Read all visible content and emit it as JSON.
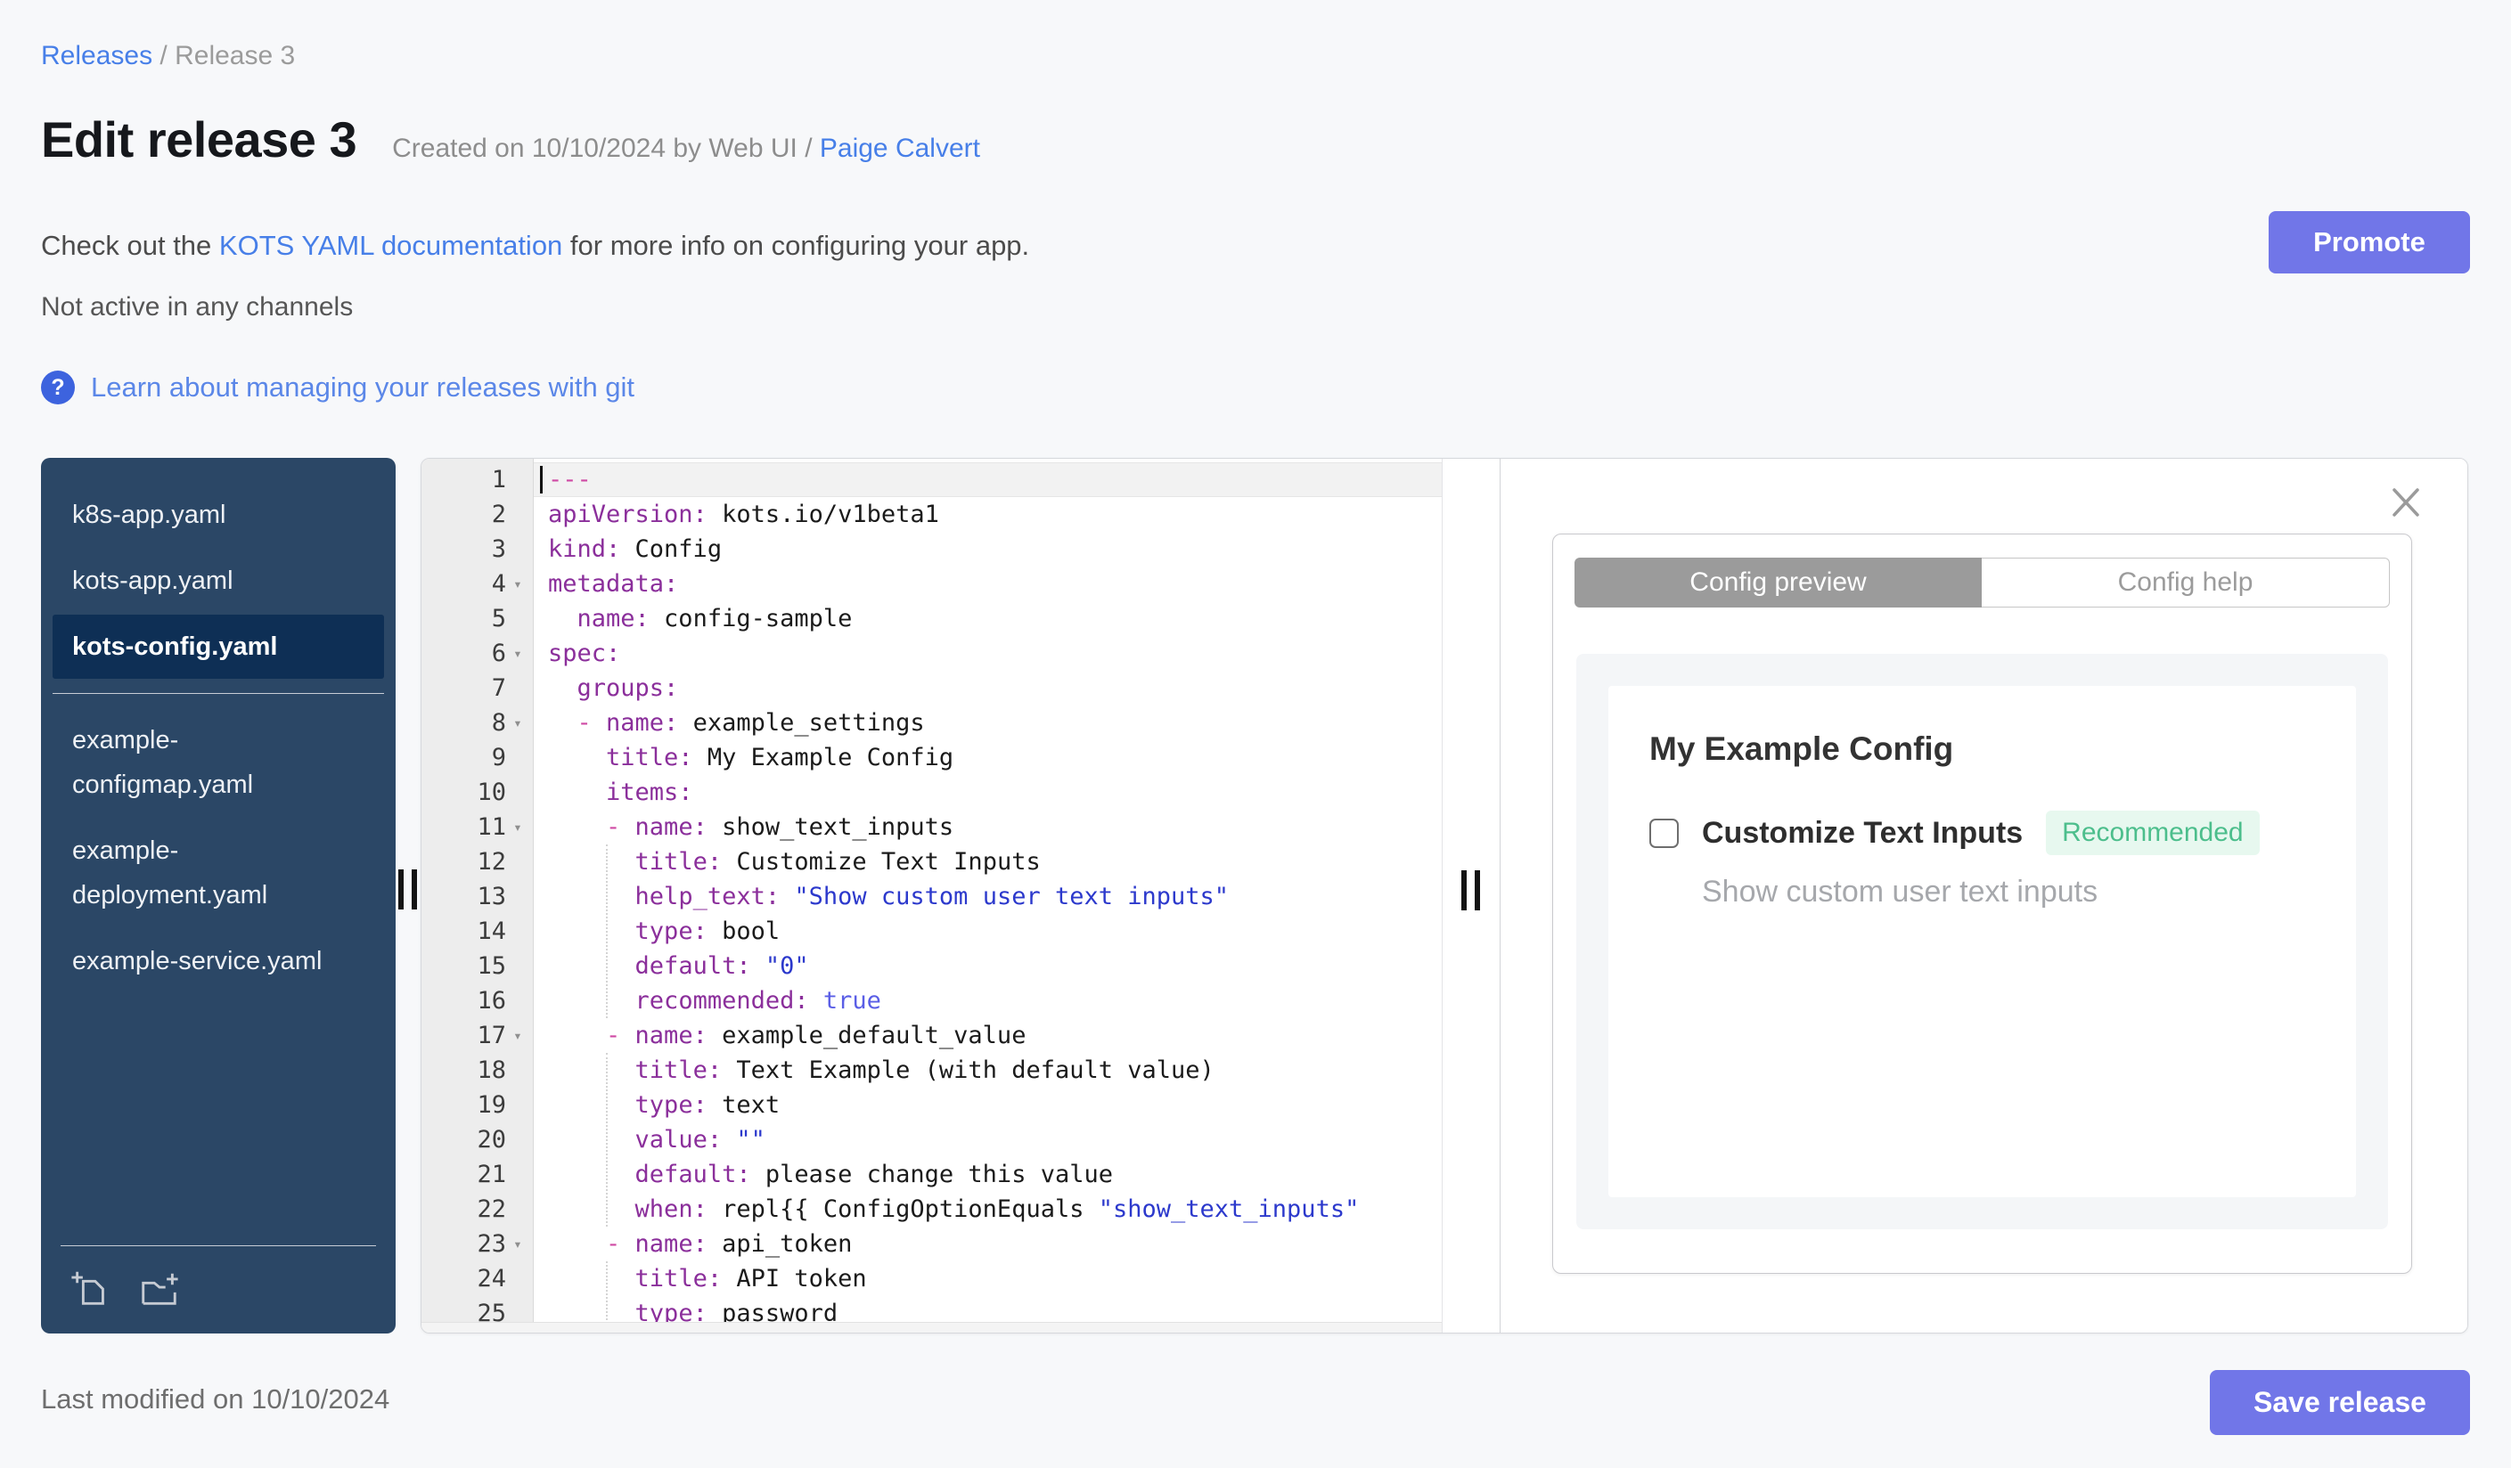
{
  "breadcrumb": {
    "link": "Releases",
    "separator": " / ",
    "current": "Release 3"
  },
  "header": {
    "title": "Edit release 3",
    "created_prefix": "Created on 10/10/2024 by Web UI / ",
    "created_link": "Paige Calvert"
  },
  "info": {
    "check_prefix": "Check out the ",
    "docs_link": "KOTS YAML documentation",
    "check_suffix": " for more info on configuring your app.",
    "channel_status": "Not active in any channels",
    "help_icon": "question-mark-icon",
    "help_icon_glyph": "?",
    "help_link": "Learn about managing your releases with git"
  },
  "actions": {
    "promote": "Promote",
    "save": "Save release",
    "last_modified": "Last modified on 10/10/2024"
  },
  "colors": {
    "accent_button": "#7176e8",
    "link_blue": "#477fe8",
    "sidebar_bg": "#2b4766",
    "sidebar_selected_bg": "#0e2f55",
    "tab_active_bg": "#9b9b9b",
    "badge_green_text": "#4cbe8c",
    "badge_green_bg": "#e7f8ef",
    "yaml_key": "#8b2f9b",
    "yaml_string": "#2c39cc"
  },
  "file_tree": {
    "items": [
      {
        "label": "k8s-app.yaml",
        "selected": false,
        "divider_after": false
      },
      {
        "label": "kots-app.yaml",
        "selected": false,
        "divider_after": false
      },
      {
        "label": "kots-config.yaml",
        "selected": true,
        "divider_after": true
      },
      {
        "label": "example-configmap.yaml",
        "selected": false,
        "divider_after": false
      },
      {
        "label": "example-deployment.yaml",
        "selected": false,
        "divider_after": false
      },
      {
        "label": "example-service.yaml",
        "selected": false,
        "divider_after": false
      }
    ],
    "footer_icons": [
      "new-file-icon",
      "new-folder-icon"
    ]
  },
  "editor": {
    "active_line": 1,
    "lines": [
      {
        "n": 1,
        "fold": false,
        "tokens": [
          [
            "meta",
            "---"
          ]
        ]
      },
      {
        "n": 2,
        "fold": false,
        "tokens": [
          [
            "key",
            "apiVersion:"
          ],
          [
            "plain",
            " kots.io/v1beta1"
          ]
        ]
      },
      {
        "n": 3,
        "fold": false,
        "tokens": [
          [
            "key",
            "kind:"
          ],
          [
            "plain",
            " Config"
          ]
        ]
      },
      {
        "n": 4,
        "fold": true,
        "tokens": [
          [
            "key",
            "metadata:"
          ]
        ]
      },
      {
        "n": 5,
        "fold": false,
        "tokens": [
          [
            "plain",
            "  "
          ],
          [
            "key",
            "name:"
          ],
          [
            "plain",
            " config-sample"
          ]
        ]
      },
      {
        "n": 6,
        "fold": true,
        "tokens": [
          [
            "key",
            "spec:"
          ]
        ]
      },
      {
        "n": 7,
        "fold": false,
        "tokens": [
          [
            "plain",
            "  "
          ],
          [
            "key",
            "groups:"
          ]
        ]
      },
      {
        "n": 8,
        "fold": true,
        "tokens": [
          [
            "plain",
            "  "
          ],
          [
            "meta",
            "- "
          ],
          [
            "key",
            "name:"
          ],
          [
            "plain",
            " example_settings"
          ]
        ]
      },
      {
        "n": 9,
        "fold": false,
        "tokens": [
          [
            "plain",
            "    "
          ],
          [
            "key",
            "title:"
          ],
          [
            "plain",
            " My Example Config"
          ]
        ]
      },
      {
        "n": 10,
        "fold": false,
        "tokens": [
          [
            "plain",
            "    "
          ],
          [
            "key",
            "items:"
          ]
        ]
      },
      {
        "n": 11,
        "fold": true,
        "tokens": [
          [
            "plain",
            "    "
          ],
          [
            "meta",
            "- "
          ],
          [
            "key",
            "name:"
          ],
          [
            "plain",
            " show_text_inputs"
          ]
        ]
      },
      {
        "n": 12,
        "fold": false,
        "tokens": [
          [
            "plain",
            "      "
          ],
          [
            "key",
            "title:"
          ],
          [
            "plain",
            " Customize Text Inputs"
          ]
        ]
      },
      {
        "n": 13,
        "fold": false,
        "tokens": [
          [
            "plain",
            "      "
          ],
          [
            "key",
            "help_text:"
          ],
          [
            "plain",
            " "
          ],
          [
            "str",
            "\"Show custom user text inputs\""
          ]
        ]
      },
      {
        "n": 14,
        "fold": false,
        "tokens": [
          [
            "plain",
            "      "
          ],
          [
            "key",
            "type:"
          ],
          [
            "plain",
            " bool"
          ]
        ]
      },
      {
        "n": 15,
        "fold": false,
        "tokens": [
          [
            "plain",
            "      "
          ],
          [
            "key",
            "default:"
          ],
          [
            "plain",
            " "
          ],
          [
            "str",
            "\"0\""
          ]
        ]
      },
      {
        "n": 16,
        "fold": false,
        "tokens": [
          [
            "plain",
            "      "
          ],
          [
            "key",
            "recommended:"
          ],
          [
            "plain",
            " "
          ],
          [
            "atom",
            "true"
          ]
        ]
      },
      {
        "n": 17,
        "fold": true,
        "tokens": [
          [
            "plain",
            "    "
          ],
          [
            "meta",
            "- "
          ],
          [
            "key",
            "name:"
          ],
          [
            "plain",
            " example_default_value"
          ]
        ]
      },
      {
        "n": 18,
        "fold": false,
        "tokens": [
          [
            "plain",
            "      "
          ],
          [
            "key",
            "title:"
          ],
          [
            "plain",
            " Text Example (with default value)"
          ]
        ]
      },
      {
        "n": 19,
        "fold": false,
        "tokens": [
          [
            "plain",
            "      "
          ],
          [
            "key",
            "type:"
          ],
          [
            "plain",
            " text"
          ]
        ]
      },
      {
        "n": 20,
        "fold": false,
        "tokens": [
          [
            "plain",
            "      "
          ],
          [
            "key",
            "value:"
          ],
          [
            "plain",
            " "
          ],
          [
            "str",
            "\"\""
          ]
        ]
      },
      {
        "n": 21,
        "fold": false,
        "tokens": [
          [
            "plain",
            "      "
          ],
          [
            "key",
            "default:"
          ],
          [
            "plain",
            " please change this value"
          ]
        ]
      },
      {
        "n": 22,
        "fold": false,
        "tokens": [
          [
            "plain",
            "      "
          ],
          [
            "key",
            "when:"
          ],
          [
            "plain",
            " repl{{ ConfigOptionEquals "
          ],
          [
            "str",
            "\"show_text_inputs\""
          ]
        ]
      },
      {
        "n": 23,
        "fold": true,
        "tokens": [
          [
            "plain",
            "    "
          ],
          [
            "meta",
            "- "
          ],
          [
            "key",
            "name:"
          ],
          [
            "plain",
            " api_token"
          ]
        ]
      },
      {
        "n": 24,
        "fold": false,
        "tokens": [
          [
            "plain",
            "      "
          ],
          [
            "key",
            "title:"
          ],
          [
            "plain",
            " API token"
          ]
        ]
      },
      {
        "n": 25,
        "fold": false,
        "tokens": [
          [
            "plain",
            "      "
          ],
          [
            "key",
            "type:"
          ],
          [
            "plain",
            " password"
          ]
        ]
      }
    ],
    "indent_guides": [
      {
        "col": 4,
        "from": 12,
        "to": 16
      },
      {
        "col": 4,
        "from": 18,
        "to": 22
      },
      {
        "col": 4,
        "from": 24,
        "to": 25
      }
    ]
  },
  "preview": {
    "tabs": [
      {
        "label": "Config preview",
        "active": true
      },
      {
        "label": "Config help",
        "active": false
      }
    ],
    "close_icon": "close-icon",
    "group_title": "My Example Config",
    "item": {
      "label": "Customize Text Inputs",
      "badge": "Recommended",
      "help": "Show custom user text inputs",
      "checked": false
    }
  }
}
